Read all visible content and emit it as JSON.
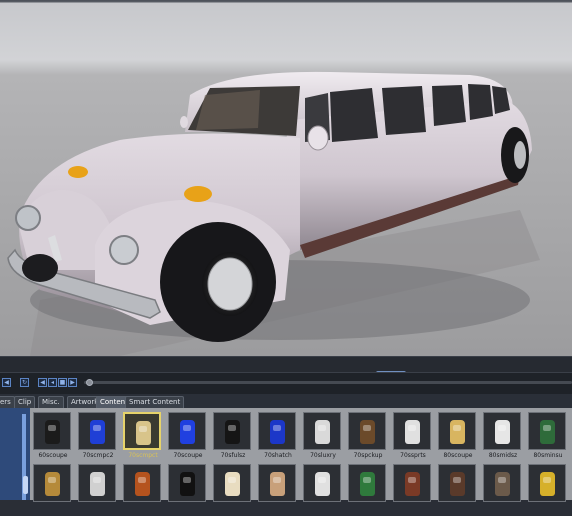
{
  "tabs": [
    {
      "label": "ers",
      "active": false
    },
    {
      "label": "Clip",
      "active": false
    },
    {
      "label": "Misc.",
      "active": false
    },
    {
      "label": "Artwork",
      "active": false
    },
    {
      "label": "Content",
      "active": true
    },
    {
      "label": "Smart Content",
      "active": false
    }
  ],
  "library": {
    "items": [
      {
        "label": "60scoupe",
        "color": "#1b1b1b",
        "icon": "car-part-dark-icon"
      },
      {
        "label": "70scmpc2",
        "color": "#1f3fd6",
        "icon": "car-part-blue-icon"
      },
      {
        "label": "70scmpct",
        "color": "#d8c48a",
        "icon": "car-part-tan-icon",
        "selected": true
      },
      {
        "label": "70scoupe",
        "color": "#2040e0",
        "icon": "car-part-blue-icon"
      },
      {
        "label": "70sfulsz",
        "color": "#151515",
        "icon": "car-part-dark-icon"
      },
      {
        "label": "70shatch",
        "color": "#1c37c8",
        "icon": "car-part-blue-icon"
      },
      {
        "label": "70sluxry",
        "color": "#d9d9d9",
        "icon": "car-part-white-icon"
      },
      {
        "label": "70spckup",
        "color": "#6b4a2a",
        "icon": "car-part-brown-icon"
      },
      {
        "label": "70ssprts",
        "color": "#e0e0e0",
        "icon": "car-part-white-icon"
      },
      {
        "label": "80scoupe",
        "color": "#d8b560",
        "icon": "car-part-tan-icon"
      },
      {
        "label": "80smidsz",
        "color": "#e6e6e6",
        "icon": "car-part-white-icon"
      },
      {
        "label": "80sminsu",
        "color": "#2e6b3a",
        "icon": "car-part-green-icon"
      }
    ],
    "second_row": [
      {
        "color": "#b58a3a",
        "icon": "car-part-orange-icon"
      },
      {
        "color": "#d0d0d0",
        "icon": "car-part-white-icon"
      },
      {
        "color": "#b5531e",
        "icon": "car-part-orange-icon"
      },
      {
        "color": "#111111",
        "icon": "car-part-dark-icon"
      },
      {
        "color": "#e8dcc0",
        "icon": "car-part-cream-icon"
      },
      {
        "color": "#c8a07a",
        "icon": "car-part-skin-icon"
      },
      {
        "color": "#e0e0e0",
        "icon": "car-part-white-icon"
      },
      {
        "color": "#2f7a3c",
        "icon": "car-part-green-icon"
      },
      {
        "color": "#7a3a26",
        "icon": "car-part-brown-icon"
      },
      {
        "color": "#5a3a2a",
        "icon": "car-part-brown-icon"
      },
      {
        "color": "#6b5a4a",
        "icon": "car-part-brown-icon"
      },
      {
        "color": "#d6b02a",
        "icon": "car-part-yellow-icon"
      }
    ]
  }
}
